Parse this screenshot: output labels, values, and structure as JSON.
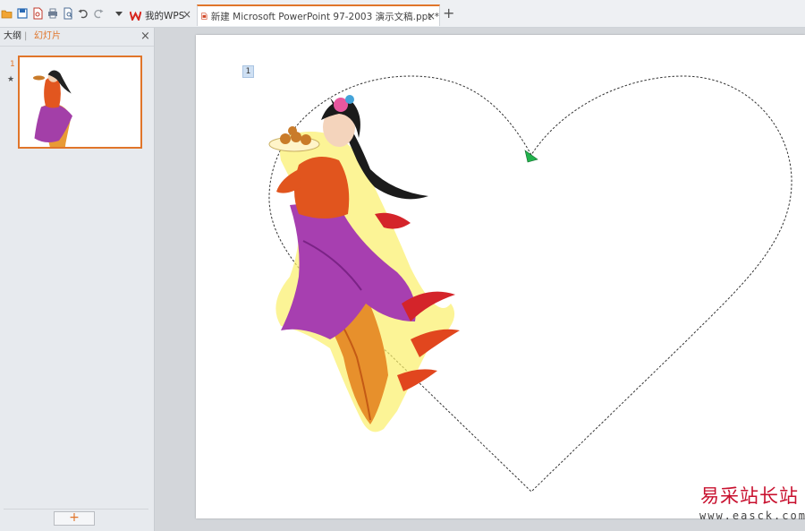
{
  "toolbar": {
    "icons": [
      "open-icon",
      "save-icon",
      "export-pdf-icon",
      "print-icon",
      "print-preview-icon",
      "undo-icon",
      "redo-icon",
      "customize-dropdown-icon"
    ]
  },
  "tabs": [
    {
      "label": "我的WPS",
      "icon": "wps-logo-icon",
      "close": "×",
      "active": false
    },
    {
      "label": "新建 Microsoft PowerPoint 97-2003 演示文稿.ppt *",
      "icon": "ppt-file-icon",
      "close": "×",
      "active": true
    }
  ],
  "new_tab": "+",
  "left_panel": {
    "tab_outline": "大纲",
    "separator": "|",
    "tab_slides": "幻灯片",
    "close": "×",
    "slide_number": "1",
    "animation_marker": "★",
    "add_slide": "+"
  },
  "canvas": {
    "animation_badge": "1",
    "motion_path": "heart"
  },
  "watermark": {
    "title": "易采站长站",
    "url": "www.easck.com"
  },
  "colors": {
    "accent": "#e0752a",
    "watermark": "#c8102e",
    "path_start": "#22b14c"
  }
}
